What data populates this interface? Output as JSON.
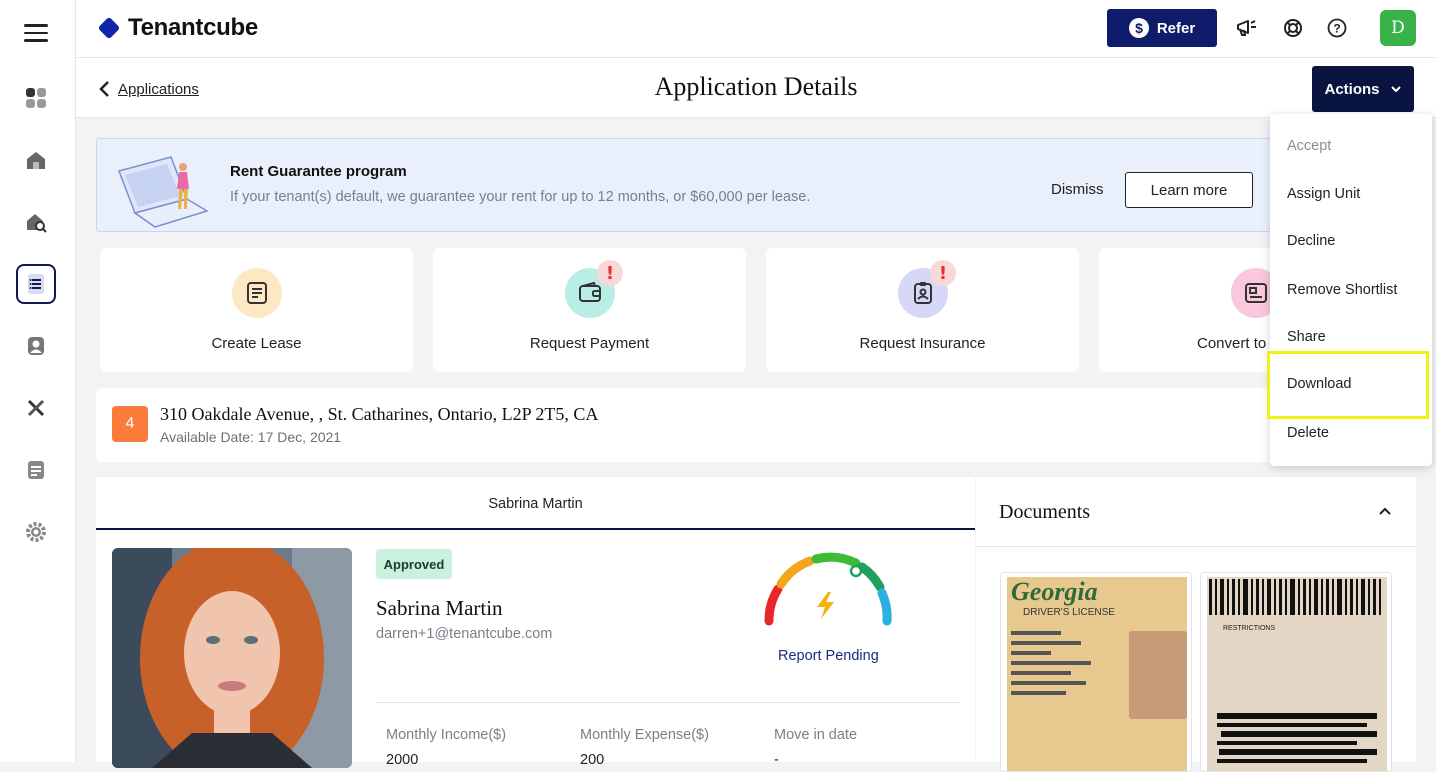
{
  "brand": {
    "name": "Tenantcube"
  },
  "header": {
    "refer_label": "Refer",
    "avatar_initial": "D"
  },
  "subheader": {
    "back_label": "Applications",
    "title": "Application Details",
    "actions_label": "Actions"
  },
  "banner": {
    "title": "Rent Guarantee program",
    "subtitle": "If your tenant(s) default, we guarantee your rent for up to 12 months, or $60,000 per lease.",
    "dismiss_label": "Dismiss",
    "learn_more_label": "Learn more"
  },
  "quick_actions": [
    {
      "label": "Create Lease",
      "icon": "lease-icon",
      "alert": false
    },
    {
      "label": "Request Payment",
      "icon": "wallet-icon",
      "alert": true
    },
    {
      "label": "Request Insurance",
      "icon": "insurance-icon",
      "alert": true
    },
    {
      "label": "Convert to",
      "icon": "convert-icon",
      "alert": false
    }
  ],
  "alert_mark": "!",
  "property": {
    "unit_number": "4",
    "address": "310 Oakdale Avenue, , St. Catharines, Ontario, L2P 2T5, CA",
    "available": "Available Date: 17 Dec, 2021"
  },
  "applicant": {
    "tab_label": "Sabrina Martin",
    "status": "Approved",
    "name": "Sabrina Martin",
    "email": "darren+1@tenantcube.com",
    "report_status": "Report Pending",
    "stats": [
      {
        "label": "Monthly Income($)",
        "value": "2000"
      },
      {
        "label": "Monthly Expense($)",
        "value": "200"
      },
      {
        "label": "Move in date",
        "value": "-"
      }
    ]
  },
  "documents": {
    "title": "Documents",
    "license_state": "Georgia",
    "license_type": "DRIVER'S LICENSE",
    "restrictions": "RESTRICTIONS"
  },
  "actions_menu": [
    {
      "label": "Accept",
      "disabled": true
    },
    {
      "label": "Assign Unit",
      "disabled": false
    },
    {
      "label": "Decline",
      "disabled": false
    },
    {
      "label": "Remove Shortlist",
      "disabled": false
    },
    {
      "label": "Share",
      "disabled": false
    },
    {
      "label": "Download",
      "disabled": false,
      "highlighted": true
    },
    {
      "label": "Delete",
      "disabled": false
    }
  ],
  "colors": {
    "primary": "#0e1c6b",
    "dark_navy": "#0a1440",
    "success": "#3ab24a",
    "highlight": "#f2f210",
    "unit_badge": "#fb7b3b"
  }
}
